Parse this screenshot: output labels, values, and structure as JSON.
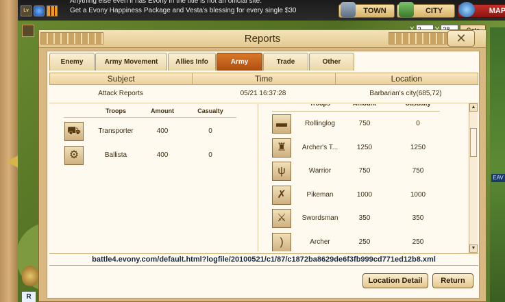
{
  "topbar": {
    "icons": [
      "lv-icon",
      "globe-icon",
      "pause-icon"
    ],
    "ticker_line1": "Anything else even if has Evony in the title is not an official site.",
    "ticker_line2": "Get a Evony Happiness Package and Vesta's blessing for every single $30",
    "town_label": "TOWN",
    "city_label": "CITY",
    "map_label": "MAP"
  },
  "coords": {
    "x_label": "X",
    "x_value": "2",
    "y_label": "Y",
    "y_value": "28",
    "goto_label": "Goto"
  },
  "window": {
    "title": "Reports",
    "close_label": "✕",
    "tabs": [
      {
        "label": "Enemy"
      },
      {
        "label": "Army Movement"
      },
      {
        "label": "Allies Info"
      },
      {
        "label": "Army",
        "active": true
      },
      {
        "label": "Trade"
      },
      {
        "label": "Other"
      }
    ],
    "columns": {
      "subject": "Subject",
      "time": "Time",
      "location": "Location"
    },
    "report": {
      "subject": "Attack Reports",
      "time": "05/21 16:37:28",
      "location": "Barbarian's city(685,72)"
    },
    "left_troops": {
      "headers": {
        "troops": "Troops",
        "amount": "Amount",
        "casualty": "Casualty"
      },
      "rows": [
        {
          "icon": "transporter-icon",
          "glyph": "⛟",
          "name": "Transporter",
          "amount": "400",
          "casualty": "0"
        },
        {
          "icon": "ballista-icon",
          "glyph": "⚙",
          "name": "Ballista",
          "amount": "400",
          "casualty": "0"
        }
      ]
    },
    "right_troops": {
      "headers": {
        "troops": "Troops",
        "amount": "Amount",
        "casualty": "Casualty"
      },
      "rows": [
        {
          "icon": "rollinglog-icon",
          "glyph": "▬",
          "name": "Rollinglog",
          "amount": "750",
          "casualty": "0"
        },
        {
          "icon": "archers-tower-icon",
          "glyph": "♜",
          "name": "Archer's T...",
          "amount": "1250",
          "casualty": "1250"
        },
        {
          "icon": "warrior-icon",
          "glyph": "ψ",
          "name": "Warrior",
          "amount": "750",
          "casualty": "750"
        },
        {
          "icon": "pikeman-icon",
          "glyph": "✗",
          "name": "Pikeman",
          "amount": "1000",
          "casualty": "1000"
        },
        {
          "icon": "swordsman-icon",
          "glyph": "⚔",
          "name": "Swordsman",
          "amount": "350",
          "casualty": "350"
        },
        {
          "icon": "archer-icon",
          "glyph": ")",
          "name": "Archer",
          "amount": "250",
          "casualty": "250"
        }
      ]
    },
    "url": "battle4.evony.com/default.html?logfile/20100521/c1/87/c1872ba8629de6f3fb999cd771ed12b8.xml",
    "location_detail_label": "Location Detail",
    "return_label": "Return"
  },
  "side": {
    "right_label": "EAV",
    "bottom_label": "R"
  },
  "colors": {
    "active_tab": "#c0621a",
    "frame": "#d9b882",
    "panel": "#fffaf0"
  }
}
